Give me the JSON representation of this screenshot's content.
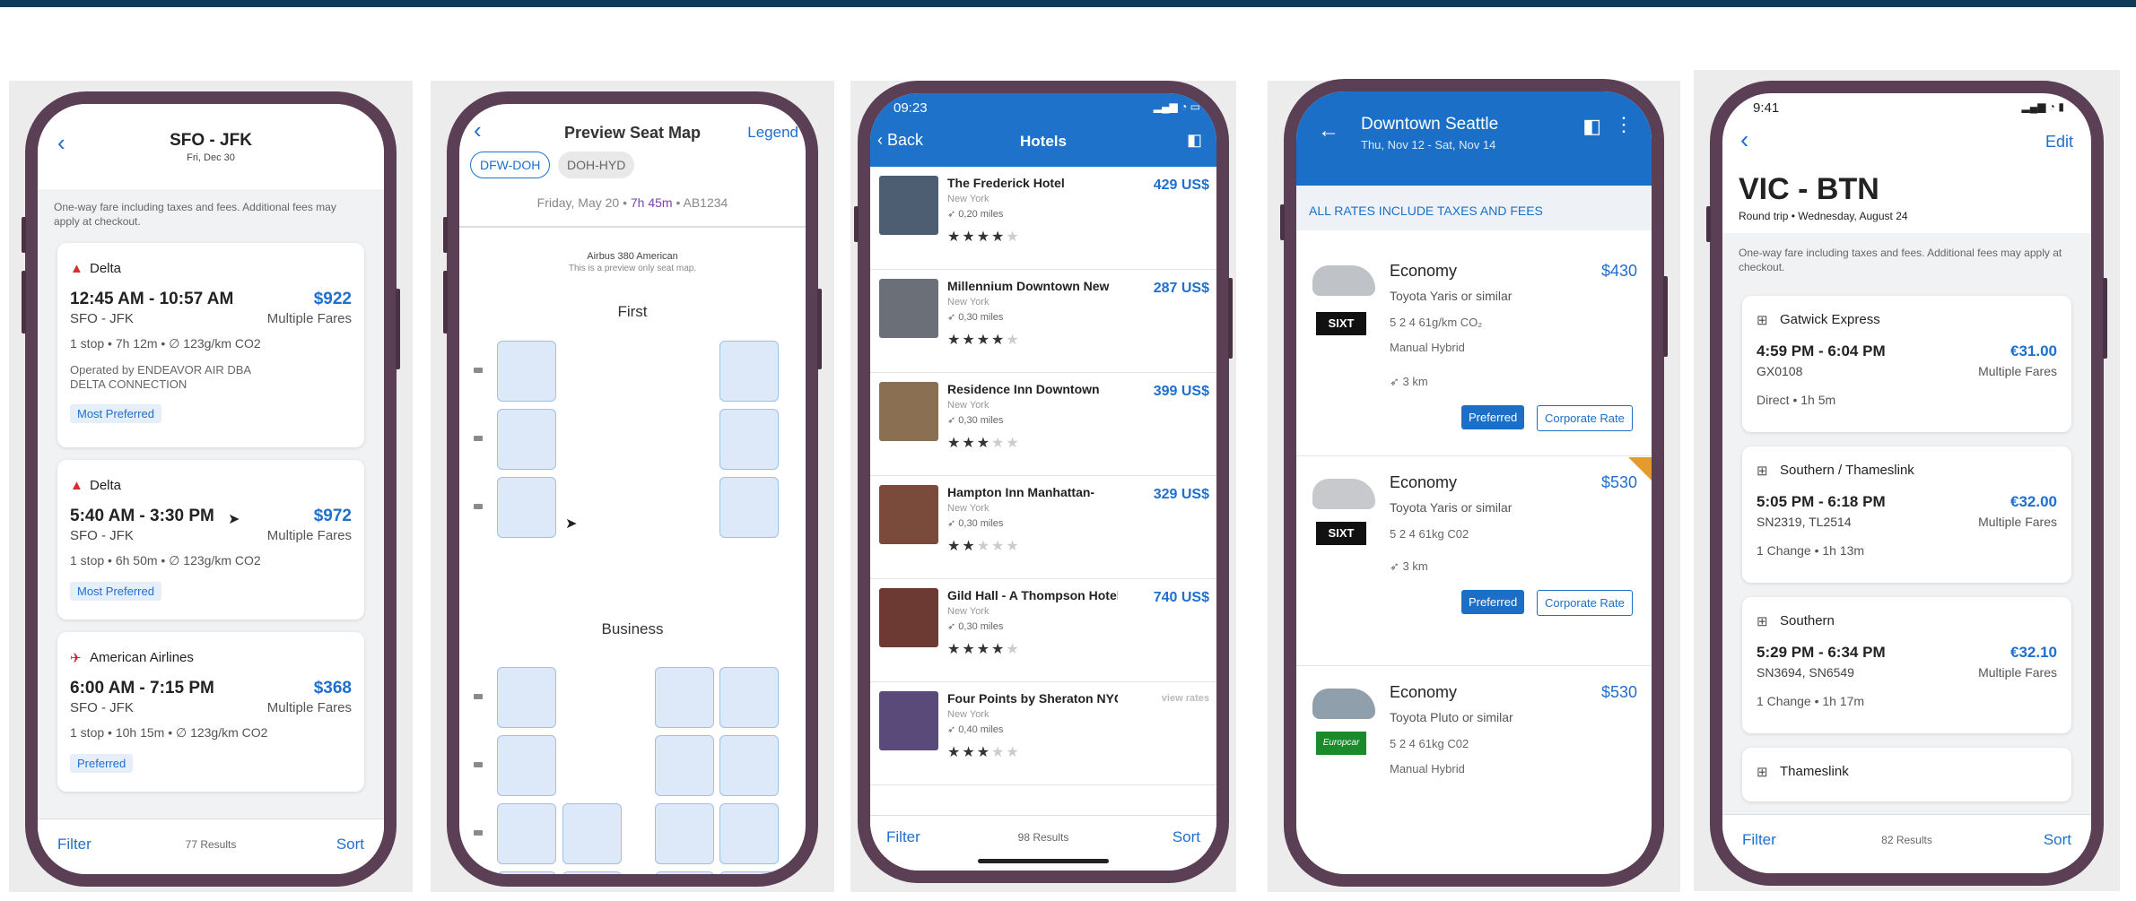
{
  "phone1": {
    "title": "SFO - JFK",
    "subtitle": "Fri, Dec 30",
    "notice": "One-way fare including taxes and fees. Additional fees may apply at checkout.",
    "flights": [
      {
        "airline": "Delta",
        "times": "12:45 AM - 10:57 AM",
        "price": "$922",
        "route": "SFO - JFK",
        "fares": "Multiple Fares",
        "details": "1 stop • 7h 12m • ∅ 123g/km CO2",
        "operated": "Operated by ENDEAVOR AIR DBA DELTA CONNECTION",
        "tag": "Most Preferred"
      },
      {
        "airline": "Delta",
        "times": "5:40 AM - 3:30 PM",
        "price": "$972",
        "route": "SFO - JFK",
        "fares": "Multiple Fares",
        "details": "1 stop • 6h 50m • ∅ 123g/km CO2",
        "tag": "Most Preferred"
      },
      {
        "airline": "American Airlines",
        "times": "6:00 AM - 7:15 PM",
        "price": "$368",
        "route": "SFO - JFK",
        "fares": "Multiple Fares",
        "details": "1 stop • 10h 15m • ∅ 123g/km CO2",
        "tag": "Preferred"
      }
    ],
    "filter": "Filter",
    "results": "77 Results",
    "sort": "Sort"
  },
  "phone2": {
    "title": "Preview Seat Map",
    "legend": "Legend",
    "tabs": [
      "DFW-DOH",
      "DOH-HYD"
    ],
    "date": "Friday, May 20 • ",
    "duration": "7h 45m",
    "flight": " • AB1234",
    "aircraft": "Airbus 380  American",
    "preview_note": "This is a preview only seat map.",
    "section_first": "First",
    "section_business": "Business"
  },
  "phone3": {
    "time": "09:23",
    "back": "Back",
    "title": "Hotels",
    "hotels": [
      {
        "name": "The Frederick Hotel",
        "city": "New York",
        "dist": "0,20 miles",
        "price": "429 US$",
        "stars": 4
      },
      {
        "name": "Millennium Downtown New",
        "city": "New York",
        "dist": "0,30 miles",
        "price": "287 US$",
        "stars": 4
      },
      {
        "name": "Residence Inn Downtown",
        "city": "New York",
        "dist": "0,30 miles",
        "price": "399 US$",
        "stars": 3
      },
      {
        "name": "Hampton Inn Manhattan-",
        "city": "New York",
        "dist": "0,30 miles",
        "price": "329 US$",
        "stars": 2
      },
      {
        "name": "Gild Hall - A Thompson Hotel",
        "city": "New York",
        "dist": "0,30 miles",
        "price": "740 US$",
        "stars": 4
      },
      {
        "name": "Four Points by Sheraton NYC",
        "city": "New York",
        "dist": "0,40 miles",
        "price": "view rates",
        "stars": 3
      }
    ],
    "filter": "Filter",
    "results": "98 Results",
    "sort": "Sort"
  },
  "phone4": {
    "title": "Downtown Seattle",
    "dates": "Thu, Nov 12 - Sat, Nov 14",
    "notice": "ALL RATES INCLUDE TAXES AND FEES",
    "cars": [
      {
        "class": "Economy",
        "price": "$430",
        "model": "Toyota Yaris or similar",
        "specs": "5   2   4   61g/km CO₂",
        "extra": "Manual   Hybrid",
        "dist": "3 km",
        "vendor": "SIXT",
        "btn1": "Preferred",
        "btn2": "Corporate Rate"
      },
      {
        "class": "Economy",
        "price": "$530",
        "model": "Toyota Yaris or similar",
        "specs": "5   2   4   61kg C02",
        "dist": "3 km",
        "vendor": "SIXT",
        "btn1": "Preferred",
        "btn2": "Corporate Rate"
      },
      {
        "class": "Economy",
        "price": "$530",
        "model": "Toyota Pluto or similar",
        "specs": "5   2   4   61kg C02",
        "extra": "Manual   Hybrid",
        "vendor": "Europcar"
      }
    ],
    "colors": {
      "header": "#1c6fc7",
      "sixt": "#111111",
      "europcar": "#1a8a2a"
    }
  },
  "phone5": {
    "time": "9:41",
    "edit": "Edit",
    "title": "VIC - BTN",
    "subtitle": "Round trip • Wednesday, August 24",
    "notice": "One-way fare including taxes and fees. Additional fees may apply at checkout.",
    "trains": [
      {
        "operator": "Gatwick Express",
        "times": "4:59 PM - 6:04 PM",
        "price": "€31.00",
        "code": "GX0108",
        "fares": "Multiple Fares",
        "details": "Direct  •  1h 5m"
      },
      {
        "operator": "Southern / Thameslink",
        "times": "5:05 PM - 6:18 PM",
        "price": "€32.00",
        "code": "SN2319, TL2514",
        "fares": "Multiple Fares",
        "details": "1 Change  •  1h 13m"
      },
      {
        "operator": "Southern",
        "times": "5:29 PM - 6:34 PM",
        "price": "€32.10",
        "code": "SN3694, SN6549",
        "fares": "Multiple Fares",
        "details": "1 Change  •  1h 17m"
      },
      {
        "operator": "Thameslink"
      }
    ],
    "filter": "Filter",
    "results": "82 Results",
    "sort": "Sort"
  }
}
